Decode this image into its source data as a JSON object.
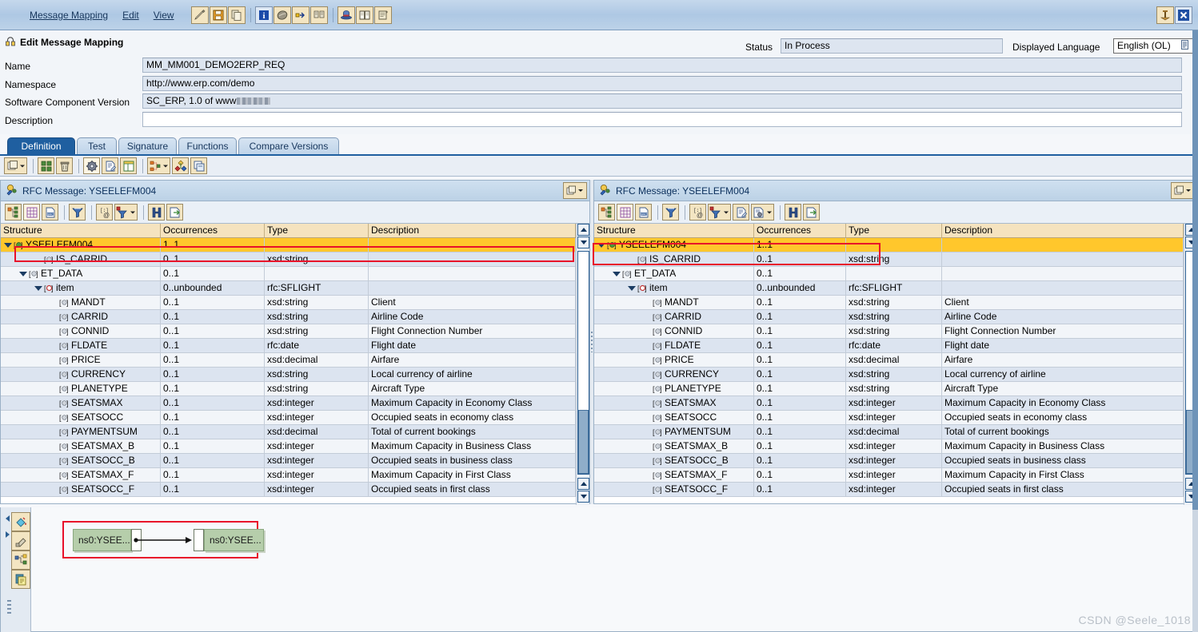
{
  "window": {
    "menu": [
      {
        "label": "Message Mapping",
        "accel": "M"
      },
      {
        "label": "Edit",
        "accel": "E"
      },
      {
        "label": "View",
        "accel": "V"
      }
    ],
    "toolbar_icons": [
      "pen-edit-icon",
      "save-icon",
      "copy-icon",
      "info-icon",
      "object-icon",
      "navigate-icon",
      "compare-icon",
      "hat-icon",
      "book-icon",
      "scroll-icon"
    ],
    "right_icons": [
      "pin-icon",
      "close-icon"
    ]
  },
  "header": {
    "title": "Edit Message Mapping",
    "title_icon": "lock-edit-icon",
    "fields": [
      {
        "label": "Name",
        "value": "MM_MM001_DEMO2ERP_REQ",
        "readonly": true
      },
      {
        "label": "Namespace",
        "value": "http://www.erp.com/demo",
        "readonly": true
      },
      {
        "label": "Software Component Version",
        "value": "SC_ERP, 1.0 of www",
        "masked": true,
        "readonly": true
      },
      {
        "label": "Description",
        "value": "",
        "readonly": false
      }
    ],
    "status_label": "Status",
    "status_value": "In Process",
    "language_label": "Displayed Language",
    "language_value": "English (OL)"
  },
  "tabs": [
    {
      "label": "Definition",
      "active": true
    },
    {
      "label": "Test",
      "active": false
    },
    {
      "label": "Signature",
      "active": false
    },
    {
      "label": "Functions",
      "active": false
    },
    {
      "label": "Compare Versions",
      "active": false
    }
  ],
  "tab_toolbar": [
    "window-stack-icon",
    "grid-blocks-icon",
    "delete-icon",
    "settings-gear-icon",
    "document-edit-icon",
    "layout-icon",
    "structure-map-icon",
    "colors-icon",
    "duplicate-icon"
  ],
  "columns": [
    "Structure",
    "Occurrences",
    "Type",
    "Description"
  ],
  "left_panel": {
    "title": "RFC Message: YSEELEFM004",
    "title_icon": "rfc-message-icon",
    "toolbar": [
      "tree-structure-icon",
      "grid-icon",
      "source-src-icon",
      "filter-funnel-icon",
      "namespace-at-icon",
      "filter-config-icon",
      "find-icon",
      "export-icon"
    ],
    "rows": [
      {
        "indent": 0,
        "name": "YSEELEFM004",
        "occ": "1..1",
        "type": "",
        "desc": "",
        "twisty": "open",
        "selected": true,
        "icon": "element-green-icon"
      },
      {
        "indent": 2,
        "name": "IS_CARRID",
        "occ": "0..1",
        "type": "xsd:string",
        "desc": "",
        "twisty": "",
        "icon": "attribute-icon"
      },
      {
        "indent": 1,
        "name": "ET_DATA",
        "occ": "0..1",
        "type": "",
        "desc": "",
        "twisty": "open",
        "icon": "attribute-icon"
      },
      {
        "indent": 2,
        "name": "item",
        "occ": "0..unbounded",
        "type": "rfc:SFLIGHT",
        "desc": "",
        "twisty": "open",
        "icon": "element-red-icon"
      },
      {
        "indent": 3,
        "name": "MANDT",
        "occ": "0..1",
        "type": "xsd:string",
        "desc": "Client",
        "twisty": "",
        "icon": "attribute-icon"
      },
      {
        "indent": 3,
        "name": "CARRID",
        "occ": "0..1",
        "type": "xsd:string",
        "desc": "Airline Code",
        "twisty": "",
        "icon": "attribute-icon"
      },
      {
        "indent": 3,
        "name": "CONNID",
        "occ": "0..1",
        "type": "xsd:string",
        "desc": "Flight Connection Number",
        "twisty": "",
        "icon": "attribute-icon"
      },
      {
        "indent": 3,
        "name": "FLDATE",
        "occ": "0..1",
        "type": "rfc:date",
        "desc": "Flight date",
        "twisty": "",
        "icon": "attribute-icon"
      },
      {
        "indent": 3,
        "name": "PRICE",
        "occ": "0..1",
        "type": "xsd:decimal",
        "desc": "Airfare",
        "twisty": "",
        "icon": "attribute-icon"
      },
      {
        "indent": 3,
        "name": "CURRENCY",
        "occ": "0..1",
        "type": "xsd:string",
        "desc": "Local currency of airline",
        "twisty": "",
        "icon": "attribute-icon"
      },
      {
        "indent": 3,
        "name": "PLANETYPE",
        "occ": "0..1",
        "type": "xsd:string",
        "desc": "Aircraft Type",
        "twisty": "",
        "icon": "attribute-icon"
      },
      {
        "indent": 3,
        "name": "SEATSMAX",
        "occ": "0..1",
        "type": "xsd:integer",
        "desc": "Maximum Capacity in Economy Class",
        "twisty": "",
        "icon": "attribute-icon"
      },
      {
        "indent": 3,
        "name": "SEATSOCC",
        "occ": "0..1",
        "type": "xsd:integer",
        "desc": "Occupied seats in economy class",
        "twisty": "",
        "icon": "attribute-icon"
      },
      {
        "indent": 3,
        "name": "PAYMENTSUM",
        "occ": "0..1",
        "type": "xsd:decimal",
        "desc": "Total of current bookings",
        "twisty": "",
        "icon": "attribute-icon"
      },
      {
        "indent": 3,
        "name": "SEATSMAX_B",
        "occ": "0..1",
        "type": "xsd:integer",
        "desc": "Maximum Capacity in Business Class",
        "twisty": "",
        "icon": "attribute-icon"
      },
      {
        "indent": 3,
        "name": "SEATSOCC_B",
        "occ": "0..1",
        "type": "xsd:integer",
        "desc": "Occupied seats in business class",
        "twisty": "",
        "icon": "attribute-icon"
      },
      {
        "indent": 3,
        "name": "SEATSMAX_F",
        "occ": "0..1",
        "type": "xsd:integer",
        "desc": "Maximum Capacity in First Class",
        "twisty": "",
        "icon": "attribute-icon"
      },
      {
        "indent": 3,
        "name": "SEATSOCC_F",
        "occ": "0..1",
        "type": "xsd:integer",
        "desc": "Occupied seats in first class",
        "twisty": "",
        "icon": "attribute-icon"
      }
    ]
  },
  "right_panel": {
    "title": "RFC Message: YSEELEFM004",
    "title_icon": "rfc-message-icon",
    "toolbar": [
      "tree-structure-icon",
      "grid-icon",
      "source-src-icon",
      "filter-funnel-icon",
      "namespace-at-icon",
      "filter-config-icon",
      "document-edit-icon",
      "settings-doc-icon",
      "find-icon",
      "export-icon"
    ],
    "rows": [
      {
        "indent": 0,
        "name": "YSEELEFM004",
        "occ": "1..1",
        "type": "",
        "desc": "",
        "twisty": "open",
        "selected": true,
        "icon": "element-green-icon"
      },
      {
        "indent": 2,
        "name": "IS_CARRID",
        "occ": "0..1",
        "type": "xsd:string",
        "desc": "",
        "twisty": "",
        "icon": "attribute-icon"
      },
      {
        "indent": 1,
        "name": "ET_DATA",
        "occ": "0..1",
        "type": "",
        "desc": "",
        "twisty": "open",
        "icon": "attribute-icon"
      },
      {
        "indent": 2,
        "name": "item",
        "occ": "0..unbounded",
        "type": "rfc:SFLIGHT",
        "desc": "",
        "twisty": "open",
        "icon": "element-red-icon"
      },
      {
        "indent": 3,
        "name": "MANDT",
        "occ": "0..1",
        "type": "xsd:string",
        "desc": "Client",
        "twisty": "",
        "icon": "attribute-icon"
      },
      {
        "indent": 3,
        "name": "CARRID",
        "occ": "0..1",
        "type": "xsd:string",
        "desc": "Airline Code",
        "twisty": "",
        "icon": "attribute-icon"
      },
      {
        "indent": 3,
        "name": "CONNID",
        "occ": "0..1",
        "type": "xsd:string",
        "desc": "Flight Connection Number",
        "twisty": "",
        "icon": "attribute-icon"
      },
      {
        "indent": 3,
        "name": "FLDATE",
        "occ": "0..1",
        "type": "rfc:date",
        "desc": "Flight date",
        "twisty": "",
        "icon": "attribute-icon"
      },
      {
        "indent": 3,
        "name": "PRICE",
        "occ": "0..1",
        "type": "xsd:decimal",
        "desc": "Airfare",
        "twisty": "",
        "icon": "attribute-icon"
      },
      {
        "indent": 3,
        "name": "CURRENCY",
        "occ": "0..1",
        "type": "xsd:string",
        "desc": "Local currency of airline",
        "twisty": "",
        "icon": "attribute-icon"
      },
      {
        "indent": 3,
        "name": "PLANETYPE",
        "occ": "0..1",
        "type": "xsd:string",
        "desc": "Aircraft Type",
        "twisty": "",
        "icon": "attribute-icon"
      },
      {
        "indent": 3,
        "name": "SEATSMAX",
        "occ": "0..1",
        "type": "xsd:integer",
        "desc": "Maximum Capacity in Economy Class",
        "twisty": "",
        "icon": "attribute-icon"
      },
      {
        "indent": 3,
        "name": "SEATSOCC",
        "occ": "0..1",
        "type": "xsd:integer",
        "desc": "Occupied seats in economy class",
        "twisty": "",
        "icon": "attribute-icon"
      },
      {
        "indent": 3,
        "name": "PAYMENTSUM",
        "occ": "0..1",
        "type": "xsd:decimal",
        "desc": "Total of current bookings",
        "twisty": "",
        "icon": "attribute-icon"
      },
      {
        "indent": 3,
        "name": "SEATSMAX_B",
        "occ": "0..1",
        "type": "xsd:integer",
        "desc": "Maximum Capacity in Business Class",
        "twisty": "",
        "icon": "attribute-icon"
      },
      {
        "indent": 3,
        "name": "SEATSOCC_B",
        "occ": "0..1",
        "type": "xsd:integer",
        "desc": "Occupied seats in business class",
        "twisty": "",
        "icon": "attribute-icon"
      },
      {
        "indent": 3,
        "name": "SEATSMAX_F",
        "occ": "0..1",
        "type": "xsd:integer",
        "desc": "Maximum Capacity in First Class",
        "twisty": "",
        "icon": "attribute-icon"
      },
      {
        "indent": 3,
        "name": "SEATSOCC_F",
        "occ": "0..1",
        "type": "xsd:integer",
        "desc": "Occupied seats in first class",
        "twisty": "",
        "icon": "attribute-icon"
      }
    ]
  },
  "mapping_editor": {
    "rail_icons": [
      "paint-bucket-icon",
      "eraser-icon",
      "structure-link-icon",
      "clipboard-icon"
    ],
    "source_node": "ns0:YSEE...",
    "target_node": "ns0:YSEE..."
  },
  "watermark": "CSDN @Seele_1018",
  "colors": {
    "selection_yellow": "#FFC72C",
    "highlight_red": "#E8102A",
    "row_alt_blue": "#DCE4F0",
    "row_norm": "#F2F5F9",
    "header_tan": "#F5E3BF",
    "active_tab_blue": "#1F5FA0",
    "map_node_green": "#B6CEAB"
  }
}
